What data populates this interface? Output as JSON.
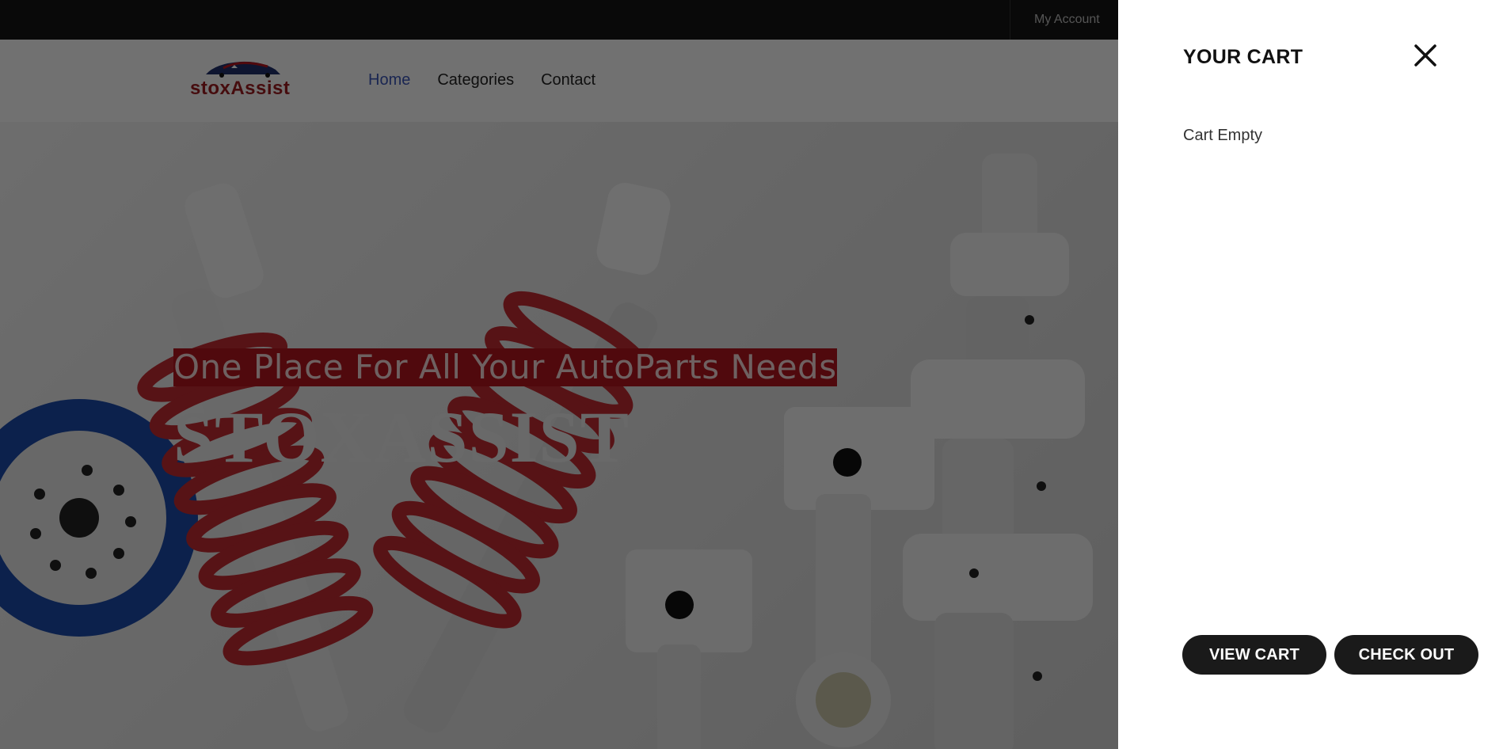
{
  "topbar": {
    "account_label": "My Account"
  },
  "header": {
    "logo_text": "stoxAssist",
    "nav": [
      {
        "label": "Home",
        "active": true
      },
      {
        "label": "Categories",
        "active": false
      },
      {
        "label": "Contact",
        "active": false
      }
    ]
  },
  "hero": {
    "tagline": "One Place For All Your AutoParts Needs",
    "brand": "STOXASSIST"
  },
  "cart": {
    "title": "YOUR CART",
    "empty_text": "Cart Empty",
    "view_cart_label": "VIEW CART",
    "checkout_label": "CHECK OUT",
    "close_icon": "close-icon"
  },
  "colors": {
    "brand_red": "#b1141d",
    "nav_active": "#3b55b7",
    "button_dark": "#1a1a1a"
  }
}
